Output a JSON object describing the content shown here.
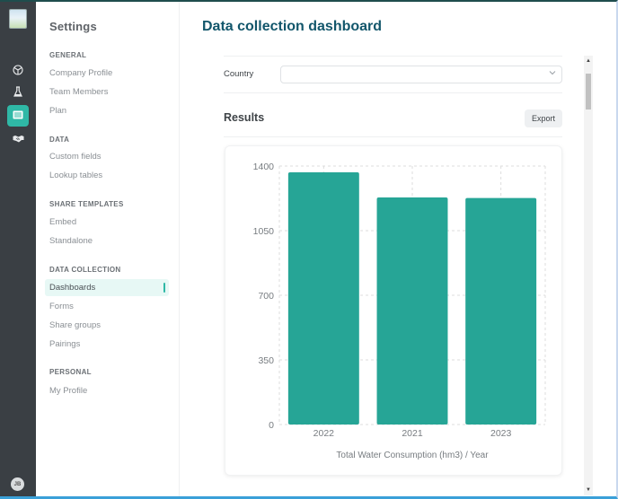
{
  "rail": {
    "items": [
      {
        "icon": "cube-icon",
        "active": false
      },
      {
        "icon": "flask-icon",
        "active": false
      },
      {
        "icon": "table-list-icon",
        "active": true
      },
      {
        "icon": "handshake-icon",
        "active": false
      }
    ],
    "avatar_initials": "JB"
  },
  "sidebar": {
    "title": "Settings",
    "sections": [
      {
        "label": "GENERAL",
        "items": [
          "Company Profile",
          "Team Members",
          "Plan"
        ]
      },
      {
        "label": "DATA",
        "items": [
          "Custom fields",
          "Lookup tables"
        ]
      },
      {
        "label": "SHARE TEMPLATES",
        "items": [
          "Embed",
          "Standalone"
        ]
      },
      {
        "label": "DATA COLLECTION",
        "items": [
          "Dashboards",
          "Forms",
          "Share groups",
          "Pairings"
        ]
      },
      {
        "label": "PERSONAL",
        "items": [
          "My Profile"
        ]
      }
    ],
    "active_item": "Dashboards"
  },
  "main": {
    "title": "Data collection dashboard",
    "filter": {
      "label": "Country",
      "value": ""
    },
    "results_title": "Results",
    "export_label": "Export"
  },
  "colors": {
    "accent": "#2fb8a6",
    "bar": "#26a596",
    "title": "#12566b",
    "rail_bg": "#3a3f44"
  },
  "chart_data": {
    "type": "bar",
    "categories": [
      "2022",
      "2021",
      "2023"
    ],
    "values": [
      1366,
      1230,
      1227
    ],
    "title": "",
    "xlabel": "Total Water Consumption (hm3) / Year",
    "ylabel": "",
    "ylim": [
      0,
      1400
    ],
    "yticks": [
      0,
      350,
      700,
      1050,
      1400
    ],
    "grid": true,
    "legend": "none"
  }
}
